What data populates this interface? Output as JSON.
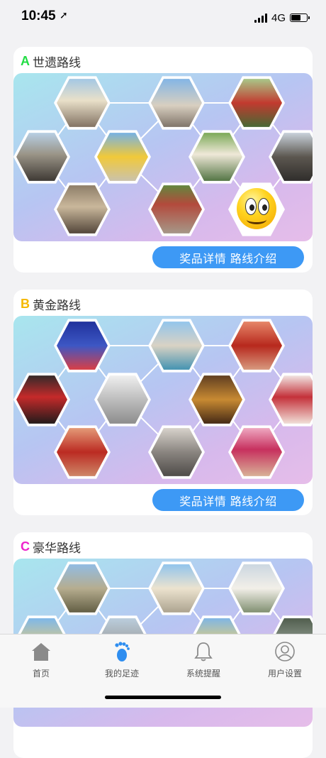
{
  "status_bar": {
    "time": "10:45",
    "network": "4G",
    "battery_level": 0.6
  },
  "routes": [
    {
      "letter": "A",
      "name": "世遗路线",
      "letter_color": "#22dd44",
      "button_label": "奖品详情 路线介绍",
      "tiles": [
        {
          "kind": "photo",
          "bg": "linear-gradient(180deg,#9fc6e6 0%,#e9e0c9 45%,#7d6d5e 100%)"
        },
        {
          "kind": "photo",
          "bg": "linear-gradient(180deg,#7fb4e8 0%,#d8cfc0 55%,#7a6e63 100%)"
        },
        {
          "kind": "photo",
          "bg": "linear-gradient(180deg,#a7d08e 0%,#c23a2f 50%,#3f6b34 100%)"
        },
        {
          "kind": "photo",
          "bg": "linear-gradient(180deg,#b9d3ea 0%,#9a9487 45%,#3a3530 100%)"
        },
        {
          "kind": "photo",
          "bg": "linear-gradient(180deg,#6fb0ee 0%,#f1c93a 50%,#c8c2b2 100%)"
        },
        {
          "kind": "photo",
          "bg": "linear-gradient(180deg,#74a54f 0%,#efe8d8 45%,#4b6f3c 100%)"
        },
        {
          "kind": "photo",
          "bg": "linear-gradient(180deg,#cfd9e3 0%,#5c5750 50%,#2d2b29 100%)"
        },
        {
          "kind": "photo",
          "bg": "linear-gradient(180deg,#8a7a65 0%,#c9b79b 45%,#4d4035 100%)"
        },
        {
          "kind": "photo",
          "bg": "linear-gradient(180deg,#5d8b3e 0%,#b34a3c 40%,#a59b8c 100%)"
        },
        {
          "kind": "emoji"
        }
      ]
    },
    {
      "letter": "B",
      "name": "黄金路线",
      "letter_color": "#f5b800",
      "button_label": "奖品详情 路线介绍",
      "tiles": [
        {
          "kind": "photo",
          "bg": "linear-gradient(180deg,#1e2f9a 0%,#3d57c4 50%,#e33d3d 100%)"
        },
        {
          "kind": "photo",
          "bg": "linear-gradient(180deg,#8ec4ee 0%,#d9d2c4 50%,#3b8fb0 100%)"
        },
        {
          "kind": "photo",
          "bg": "linear-gradient(180deg,#e98c6d 0%,#b7281d 50%,#d9a084 100%)"
        },
        {
          "kind": "photo",
          "bg": "linear-gradient(180deg,#2a2a2a 0%,#c52a2a 45%,#1a1a1a 100%)"
        },
        {
          "kind": "photo",
          "bg": "linear-gradient(180deg,#f2f2f2 0%,#bdbdbd 50%,#8a8a8a 100%)"
        },
        {
          "kind": "photo",
          "bg": "linear-gradient(180deg,#5a3a20 0%,#c88a32 50%,#3d2414 100%)"
        },
        {
          "kind": "photo",
          "bg": "linear-gradient(180deg,#f4f1ee 0%,#c4313a 45%,#f3e8e0 100%)"
        },
        {
          "kind": "photo",
          "bg": "linear-gradient(180deg,#e6a07c 0%,#bb2b22 50%,#cf8c6c 100%)"
        },
        {
          "kind": "photo",
          "bg": "linear-gradient(180deg,#dcd7d0 0%,#8a8580 50%,#4b4845 100%)"
        },
        {
          "kind": "photo",
          "bg": "linear-gradient(180deg,#f1b0c7 0%,#c7305e 45%,#d9b89a 100%)"
        }
      ]
    },
    {
      "letter": "C",
      "name": "豪华路线",
      "letter_color": "#ee22cc",
      "button_label": "",
      "tiles": [
        {
          "kind": "photo",
          "bg": "linear-gradient(180deg,#8fbde8 0%,#b6ad8f 50%,#5e5a40 100%)"
        },
        {
          "kind": "photo",
          "bg": "linear-gradient(180deg,#8cc2ee 0%,#ece3cf 50%,#a9a08c 100%)"
        },
        {
          "kind": "photo",
          "bg": "linear-gradient(180deg,#c9d5e0 0%,#f2efe8 50%,#7a8a6a 100%)"
        },
        {
          "kind": "photo",
          "bg": "linear-gradient(180deg,#79b6ee 0%,#e7cd7c 60%,#c3b79a 100%)"
        },
        {
          "kind": "photo",
          "bg": "linear-gradient(180deg,#bcd0e0 0%,#9a9a9a 60%,#6a6a6a 100%)"
        },
        {
          "kind": "photo",
          "bg": "linear-gradient(180deg,#7ab4ea 0%,#f2d36b 60%,#cfc5a8 100%)"
        },
        {
          "kind": "photo",
          "bg": "linear-gradient(180deg,#4d5a4a 0%,#9aa59a 60%,#5b6b57 100%)"
        }
      ]
    }
  ],
  "tab_bar": {
    "tabs": [
      {
        "label": "首页",
        "icon": "home-icon",
        "active": false
      },
      {
        "label": "我的足迹",
        "icon": "footprint-icon",
        "active": true
      },
      {
        "label": "系统提醒",
        "icon": "bell-icon",
        "active": false
      },
      {
        "label": "用户设置",
        "icon": "user-icon",
        "active": false
      }
    ],
    "active_color": "#2f8ef0",
    "inactive_color": "#888888"
  }
}
